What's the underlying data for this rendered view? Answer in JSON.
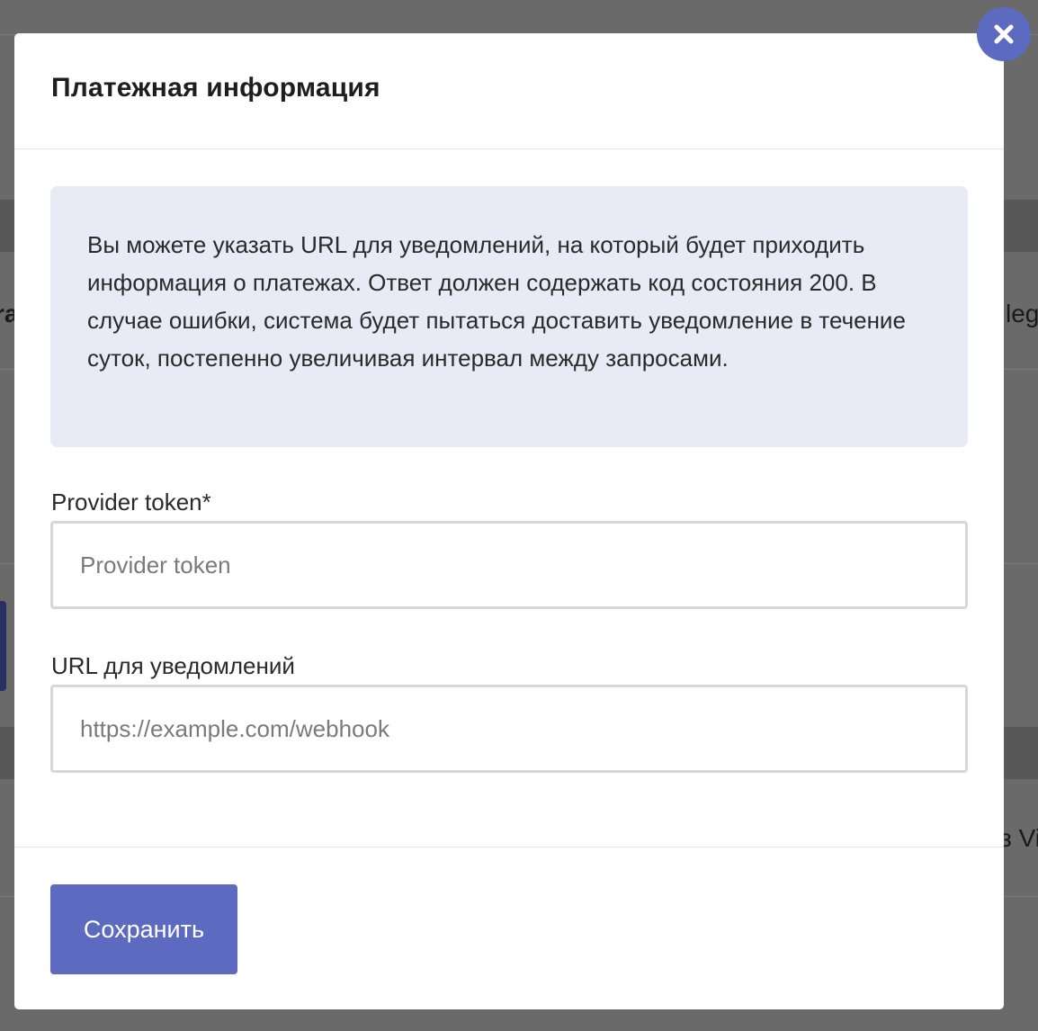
{
  "background": {
    "fragment_left": "ra",
    "fragment_right_top": "leg",
    "fragment_right_bottom": "з Vi"
  },
  "modal": {
    "title": "Платежная информация",
    "info_text": "Вы можете указать URL для уведомлений, на который будет приходить информация о платежах. Ответ должен содержать код состояния 200. В случае ошибки, система будет пытаться доставить уведомление в течение суток, постепенно увеличивая интервал между запросами.",
    "fields": {
      "provider_token": {
        "label": "Provider token*",
        "value": "",
        "placeholder": "Provider token"
      },
      "webhook_url": {
        "label": "URL для уведомлений",
        "value": "",
        "placeholder": "https://example.com/webhook"
      }
    },
    "save_label": "Сохранить",
    "close_icon": "close-icon"
  },
  "colors": {
    "accent": "#5c6bc0",
    "info_background": "#e8eaf6",
    "overlay": "#6a6a6a"
  }
}
